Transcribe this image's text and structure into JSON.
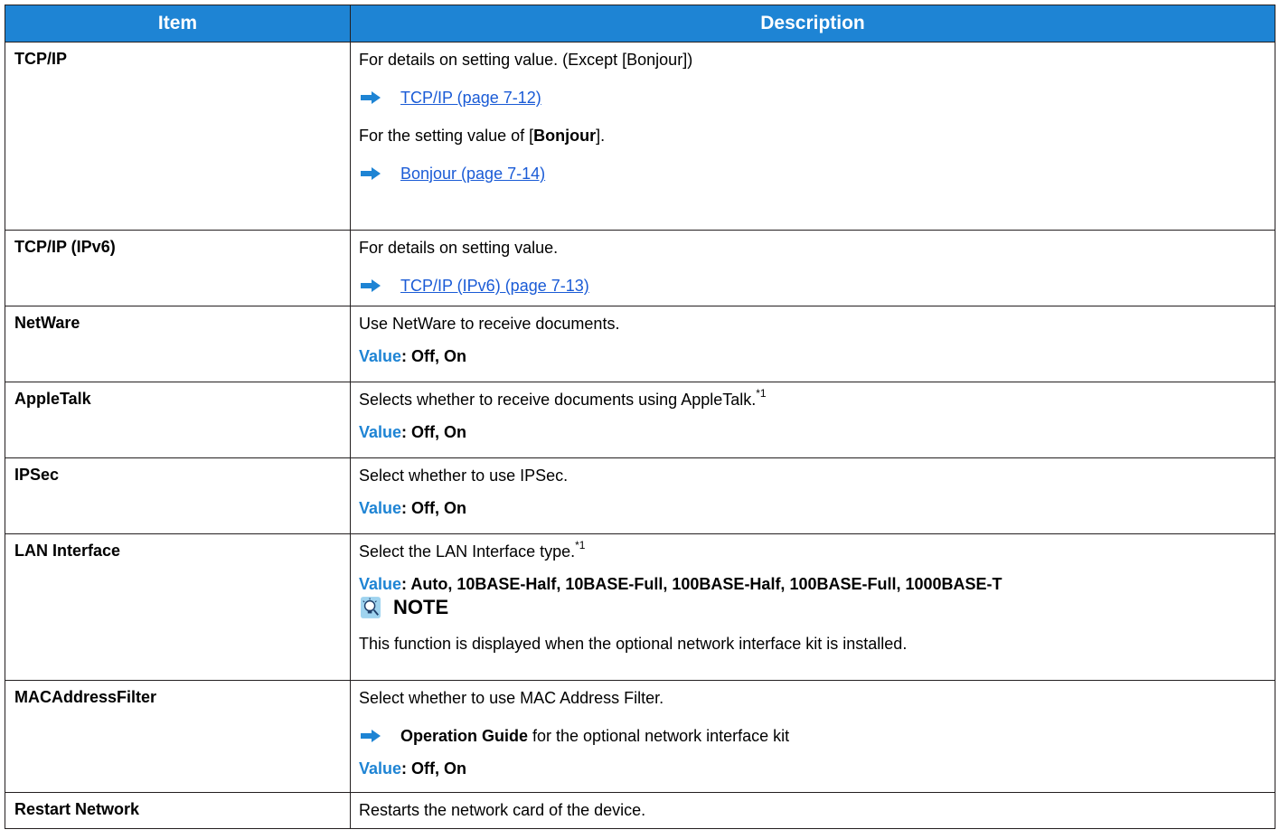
{
  "colors": {
    "header_bg": "#1e84d4",
    "header_text": "#ffffff",
    "link": "#1a5bd6",
    "value_key": "#1e84d4",
    "border": "#231f20"
  },
  "header": {
    "item": "Item",
    "description": "Description"
  },
  "rows": {
    "tcpip": {
      "item": "TCP/IP",
      "line1": "For details on setting value. (Except [Bonjour])",
      "link1": "TCP/IP (page 7-12)",
      "line2_pre": "For the setting value of [",
      "line2_bold": "Bonjour",
      "line2_post": "].",
      "link2": "Bonjour (page 7-14)"
    },
    "ipv6": {
      "item": "TCP/IP (IPv6)",
      "line1": "For details on setting value.",
      "link1": "TCP/IP (IPv6) (page 7-13)"
    },
    "netware": {
      "item": "NetWare",
      "line1": "Use NetWare to receive documents.",
      "value_key": "Value",
      "value": ": Off, On"
    },
    "appletalk": {
      "item": "AppleTalk",
      "line1": "Selects whether to receive documents using AppleTalk.",
      "footnote": "*1",
      "value_key": "Value",
      "value": ": Off, On"
    },
    "ipsec": {
      "item": "IPSec",
      "line1": "Select whether to use IPSec.",
      "value_key": "Value",
      "value": ": Off, On"
    },
    "lan": {
      "item": "LAN Interface",
      "line1": "Select the LAN Interface type.",
      "footnote": "*1",
      "value_key": "Value",
      "value": ": Auto, 10BASE-Half, 10BASE-Full, 100BASE-Half, 100BASE-Full, 1000BASE-T",
      "note_label": "NOTE",
      "note_text": "This function is displayed when the optional network interface kit is installed."
    },
    "mac": {
      "item": "MACAddressFilter",
      "line1": "Select whether to use MAC Address Filter.",
      "ref_bold": "Operation Guide",
      "ref_text": " for the optional network interface kit",
      "value_key": "Value",
      "value": ": Off, On"
    },
    "restart": {
      "item": "Restart Network",
      "line1": "Restarts the network card of the device."
    }
  }
}
